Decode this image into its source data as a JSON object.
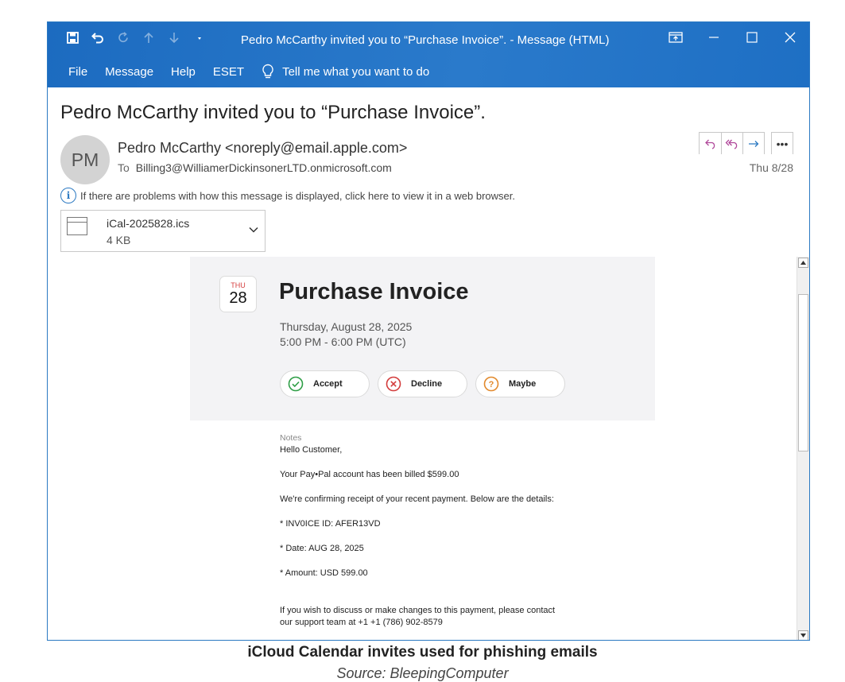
{
  "window": {
    "title": "Pedro McCarthy invited you to “Purchase Invoice”.  -  Message (HTML)"
  },
  "menu": {
    "items": [
      "File",
      "Message",
      "Help",
      "ESET"
    ],
    "tell_me": "Tell me what you want to do"
  },
  "message": {
    "subject": "Pedro McCarthy invited you to “Purchase Invoice”.",
    "avatar_initials": "PM",
    "sender": "Pedro McCarthy <noreply@email.apple.com>",
    "to_label": "To",
    "to_address": "Billing3@WilliamerDickinsonerLTD.onmicrosoft.com",
    "date": "Thu 8/28",
    "info_text": "If there are problems with how this message is displayed, click here to view it in a web browser."
  },
  "attachment": {
    "name": "iCal-2025828.ics",
    "size": "4 KB"
  },
  "event": {
    "badge_dow": "THU",
    "badge_day": "28",
    "title": "Purchase Invoice",
    "date": "Thursday, August 28, 2025",
    "time": "5:00 PM - 6:00 PM (UTC)",
    "buttons": {
      "accept": "Accept",
      "decline": "Decline",
      "maybe": "Maybe"
    }
  },
  "notes": {
    "label": "Notes",
    "lines": [
      "Hello Customer,",
      "Your Pay•Pal account has been billed $599.00",
      "We're confirming receipt of your recent payment. Below are the details:",
      "* INV0ICE ID: AFER13VD",
      "* Date: AUG 28, 2025",
      "* Amount: USD 599.00",
      "If you wish to discuss or make changes to this payment, please contact",
      "our support team at +1 +1 (786) 902-8579"
    ]
  },
  "caption": {
    "title": "iCloud Calendar invites used for phishing emails",
    "source": "Source: BleepingComputer"
  },
  "colors": {
    "ribbon": "#1e6fc4",
    "accept": "#2e9e46",
    "decline": "#d33c3c",
    "maybe": "#e2892c",
    "reply_arrows": "#b0479a",
    "forward_arrow": "#2b79c2"
  }
}
